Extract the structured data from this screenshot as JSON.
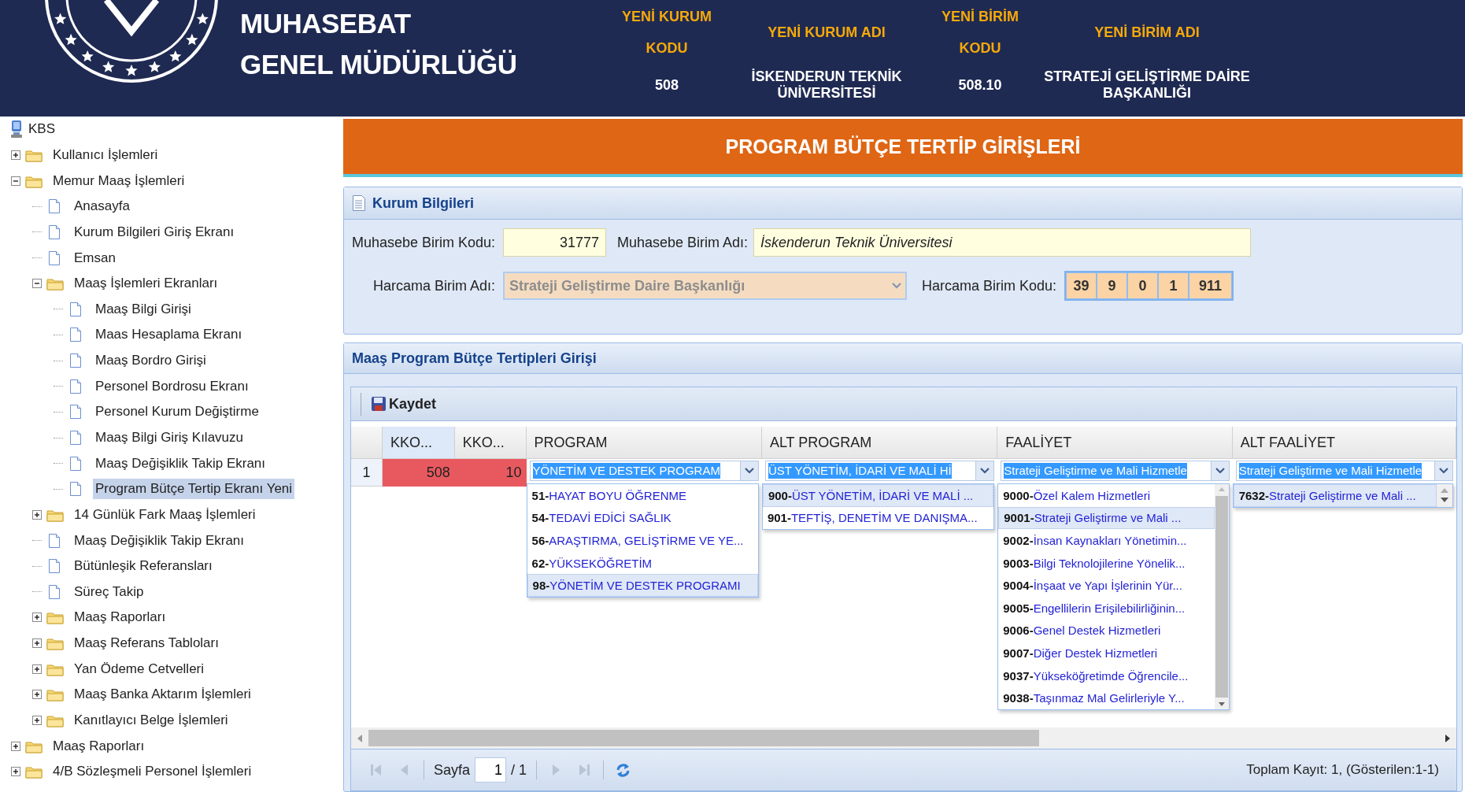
{
  "header": {
    "org_name": [
      "MUHASEBAT",
      "GENEL MÜDÜRLÜĞÜ"
    ],
    "fields": [
      {
        "label": "YENİ KURUM KODU",
        "value": "508"
      },
      {
        "label": "YENİ KURUM ADI",
        "value": "İSKENDERUN TEKNİK ÜNİVERSİTESİ"
      },
      {
        "label": "YENİ BİRİM KODU",
        "value": "508.10"
      },
      {
        "label": "YENİ BİRİM ADI",
        "value": "STRATEJİ GELİŞTİRME DAİRE BAŞKANLIĞI"
      }
    ]
  },
  "tree": {
    "root": "KBS",
    "items": [
      {
        "label": "Kullanıcı İşlemleri",
        "kind": "folder",
        "expanded": false,
        "selected": false
      },
      {
        "label": "Memur Maaş İşlemleri",
        "kind": "folder",
        "expanded": true,
        "selected": false,
        "children": [
          {
            "label": "Anasayfa",
            "kind": "page",
            "selected": false
          },
          {
            "label": "Kurum Bilgileri Giriş Ekranı",
            "kind": "page",
            "selected": false
          },
          {
            "label": "Emsan",
            "kind": "page",
            "selected": false
          },
          {
            "label": "Maaş İşlemleri Ekranları",
            "kind": "folder",
            "expanded": true,
            "selected": false,
            "children": [
              {
                "label": "Maaş Bilgi Girişi",
                "kind": "page",
                "selected": false
              },
              {
                "label": "Maas Hesaplama Ekranı",
                "kind": "page",
                "selected": false
              },
              {
                "label": "Maaş Bordro Girişi",
                "kind": "page",
                "selected": false
              },
              {
                "label": "Personel Bordrosu Ekranı",
                "kind": "page",
                "selected": false
              },
              {
                "label": "Personel Kurum Değiştirme",
                "kind": "page",
                "selected": false
              },
              {
                "label": "Maaş Bilgi Giriş Kılavuzu",
                "kind": "page",
                "selected": false
              },
              {
                "label": "Maaş Değişiklik Takip Ekranı",
                "kind": "page",
                "selected": false
              },
              {
                "label": "Program Bütçe Tertip Ekranı Yeni",
                "kind": "page",
                "selected": true
              }
            ]
          },
          {
            "label": "14 Günlük Fark Maaş İşlemleri",
            "kind": "folder",
            "expanded": false,
            "selected": false
          },
          {
            "label": "Maaş Değişiklik Takip Ekranı",
            "kind": "page",
            "selected": false
          },
          {
            "label": "Bütünleşik Referansları",
            "kind": "page",
            "selected": false
          },
          {
            "label": "Süreç Takip",
            "kind": "page",
            "selected": false
          },
          {
            "label": "Maaş Raporları",
            "kind": "folder",
            "expanded": false,
            "selected": false
          },
          {
            "label": "Maaş Referans Tabloları",
            "kind": "folder",
            "expanded": false,
            "selected": false
          },
          {
            "label": "Yan Ödeme Cetvelleri",
            "kind": "folder",
            "expanded": false,
            "selected": false
          },
          {
            "label": "Maaş Banka Aktarım İşlemleri",
            "kind": "folder",
            "expanded": false,
            "selected": false
          },
          {
            "label": "Kanıtlayıcı Belge İşlemleri",
            "kind": "folder",
            "expanded": false,
            "selected": false
          }
        ]
      },
      {
        "label": "Maaş Raporları",
        "kind": "folder",
        "expanded": false,
        "selected": false
      },
      {
        "label": "4/B Sözleşmeli Personel İşlemleri",
        "kind": "folder",
        "expanded": false,
        "selected": false
      }
    ]
  },
  "banner": {
    "title": "PROGRAM BÜTÇE TERTİP GİRİŞLERİ"
  },
  "kurum_panel": {
    "title": "Kurum Bilgileri",
    "muhasebe_kodu": {
      "label": "Muhasebe Birim Kodu:",
      "value": "31777"
    },
    "muhasebe_adi": {
      "label": "Muhasebe Birim Adı:",
      "value": "İskenderun Teknik Üniversitesi"
    },
    "harcama_adi": {
      "label": "Harcama Birim Adı:",
      "value": "Strateji Geliştirme Daire Başkanlığı",
      "disabled": true
    },
    "harcama_kodu": {
      "label": "Harcama Birim Kodu:",
      "parts": [
        "39",
        "9",
        "0",
        "1",
        "911"
      ]
    }
  },
  "grid_panel": {
    "title": "Maaş Program Bütçe Tertipleri Girişi",
    "toolbar": [
      {
        "label": "Kaydet"
      }
    ],
    "columns": [
      {
        "label": "KKO...",
        "highlighted": true
      },
      {
        "label": "KKO...",
        "highlighted": false
      },
      {
        "label": "PROGRAM",
        "highlighted": false
      },
      {
        "label": "ALT PROGRAM",
        "highlighted": false
      },
      {
        "label": "FAALİYET",
        "highlighted": false
      },
      {
        "label": "ALT FAALİYET",
        "highlighted": false
      }
    ],
    "rows": [
      {
        "number": "1",
        "invalid": true,
        "cells": [
          "508",
          "10"
        ],
        "editors": [
          {
            "value": "YÖNETİM VE DESTEK PROGRAM",
            "kind": "plain",
            "options": [
              {
                "code": "51-",
                "name": "HAYAT BOYU ÖĞRENME",
                "selected": false
              },
              {
                "code": "54-",
                "name": "TEDAVİ EDİCİ SAĞLIK",
                "selected": false
              },
              {
                "code": "56-",
                "name": "ARAŞTIRMA, GELİŞTİRME VE YE...",
                "selected": false
              },
              {
                "code": "62-",
                "name": "YÜKSEKÖĞRETİM",
                "selected": false
              },
              {
                "code": "98-",
                "name": "YÖNETİM VE DESTEK PROGRAMI",
                "selected": true
              }
            ]
          },
          {
            "value": "ÜST YÖNETİM, İDARİ VE MALİ Hİ",
            "kind": "plain",
            "options": [
              {
                "code": "900-",
                "name": "ÜST YÖNETİM, İDARİ VE MALİ ...",
                "selected": true
              },
              {
                "code": "901-",
                "name": "TEFTİŞ, DENETİM VE DANIŞMA...",
                "selected": false
              }
            ]
          },
          {
            "value": "Strateji Geliştirme ve Mali Hizmetle",
            "kind": "bar",
            "options": [
              {
                "code": "9000-",
                "name": "Özel Kalem Hizmetleri",
                "selected": false
              },
              {
                "code": "9001-",
                "name": "Strateji Geliştirme ve Mali ...",
                "selected": true
              },
              {
                "code": "9002-",
                "name": "İnsan Kaynakları Yönetimin...",
                "selected": false
              },
              {
                "code": "9003-",
                "name": "Bilgi Teknolojilerine Yönelik...",
                "selected": false
              },
              {
                "code": "9004-",
                "name": "İnşaat ve Yapı İşlerinin Yür...",
                "selected": false
              },
              {
                "code": "9005-",
                "name": "Engellilerin Erişilebilirliğinin...",
                "selected": false
              },
              {
                "code": "9006-",
                "name": "Genel Destek Hizmetleri",
                "selected": false
              },
              {
                "code": "9007-",
                "name": "Diğer Destek Hizmetleri",
                "selected": false
              },
              {
                "code": "9037-",
                "name": "Yükseköğretimde Öğrencile...",
                "selected": false
              },
              {
                "code": "9038-",
                "name": "Taşınmaz Mal Gelirleriyle Y...",
                "selected": false
              }
            ]
          },
          {
            "value": "Strateji Geliştirme ve Mali Hizmetle",
            "kind": "arrows",
            "options": [
              {
                "code": "7632-",
                "name": "Strateji Geliştirme ve Mali ...",
                "selected": true
              }
            ]
          }
        ]
      }
    ],
    "pager": {
      "buttons": [
        {
          "kind": "first",
          "disabled": true
        },
        {
          "kind": "prev",
          "disabled": true
        },
        {
          "kind": "next",
          "disabled": true
        },
        {
          "kind": "last",
          "disabled": true
        },
        {
          "kind": "refresh",
          "disabled": false
        }
      ],
      "page_label": "Sayfa",
      "page": "1",
      "page_count": "/ 1",
      "summary": "Toplam Kayıt: 1, (Gösterilen:1-1)"
    }
  }
}
